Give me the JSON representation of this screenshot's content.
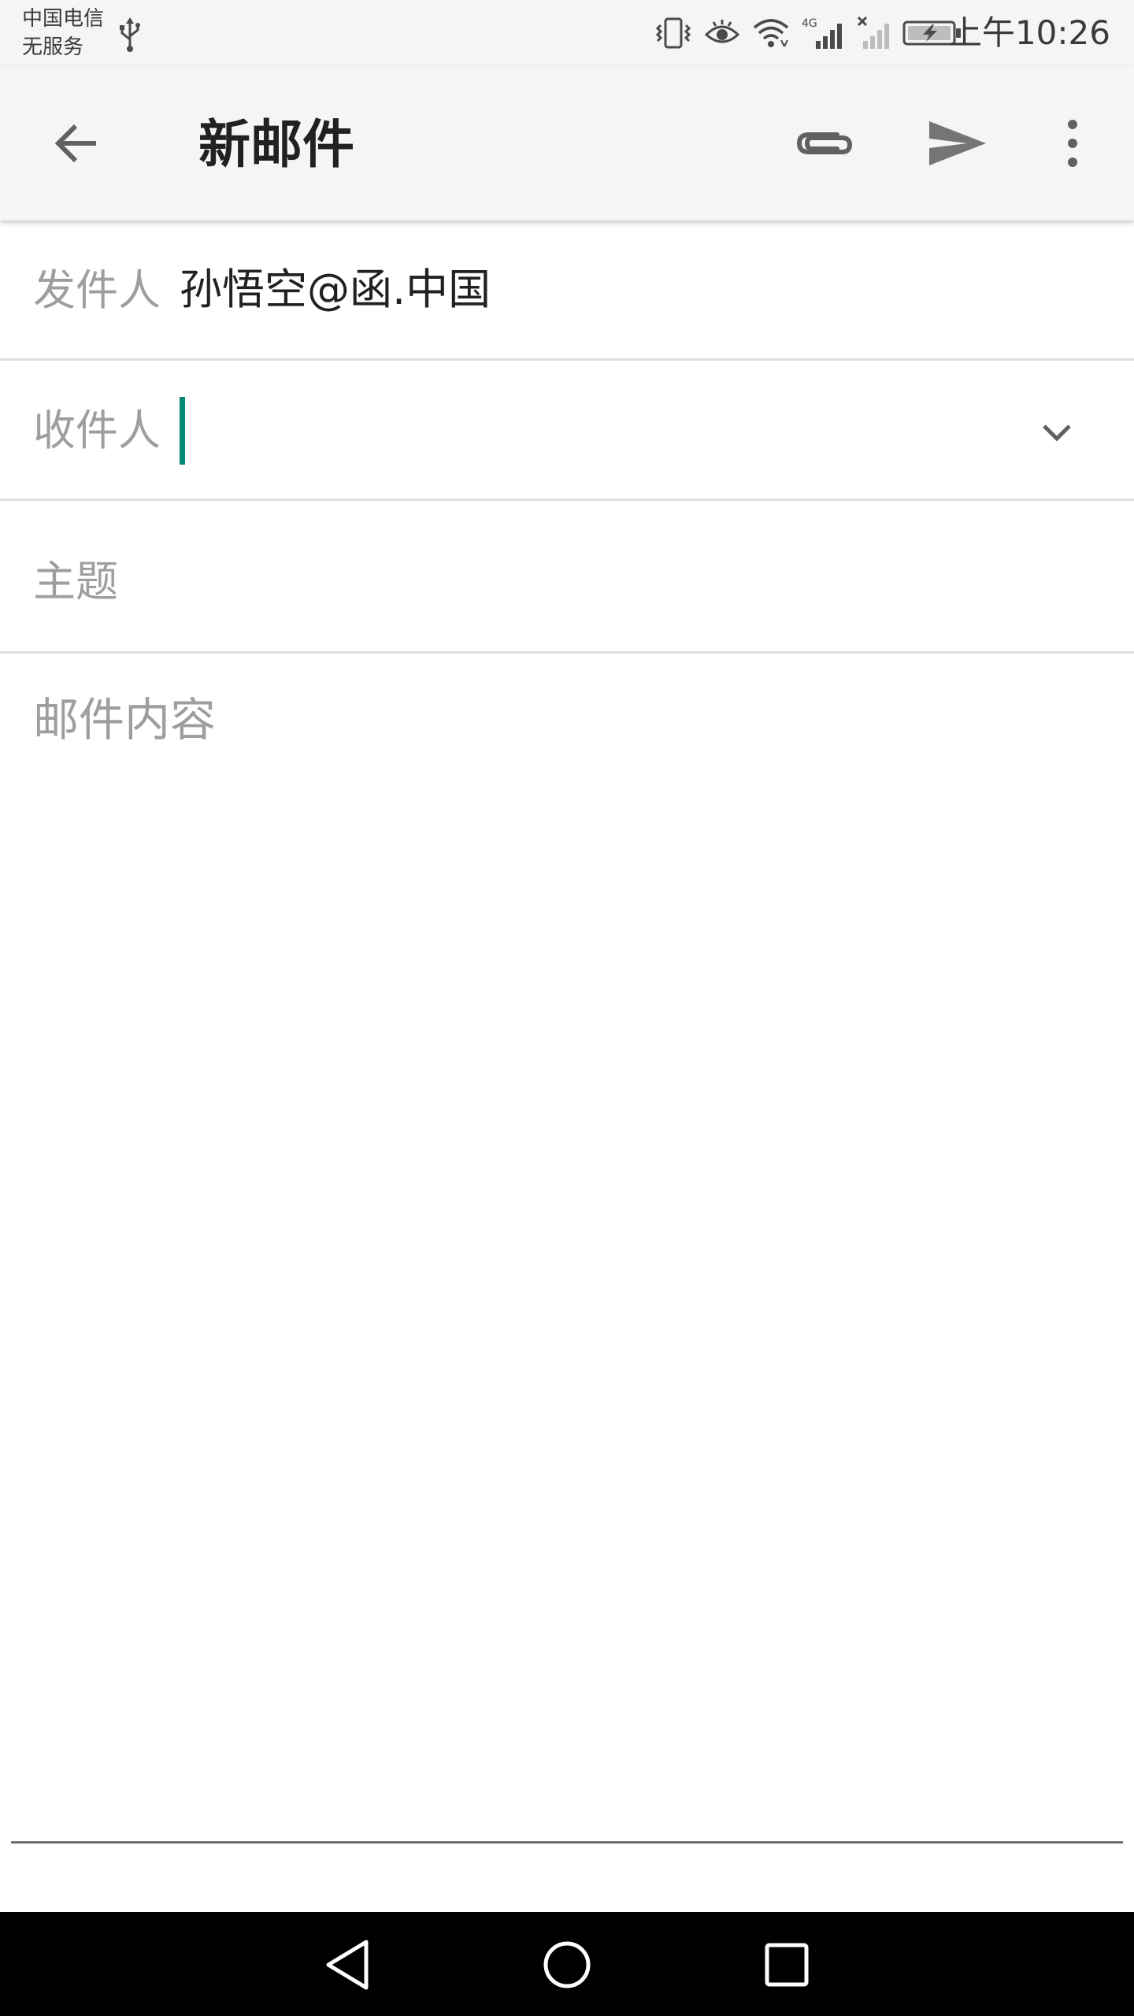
{
  "status_bar": {
    "carrier": "中国电信",
    "service": "无服务",
    "network": "4G",
    "time": "上午10:26"
  },
  "app_bar": {
    "title": "新邮件",
    "icons": [
      "back-arrow-icon",
      "paperclip-icon",
      "send-icon",
      "more-vertical-icon"
    ]
  },
  "form": {
    "from_label": "发件人",
    "from_value": "孙悟空@函.中国",
    "to_label": "收件人",
    "to_value": "",
    "subject_placeholder": "主题",
    "body_placeholder": "邮件内容"
  },
  "colors": {
    "bar_background": "#f5f5f5",
    "accent_cursor": "#00897b",
    "label_gray": "#9e9e9e",
    "text_primary": "#212121"
  }
}
